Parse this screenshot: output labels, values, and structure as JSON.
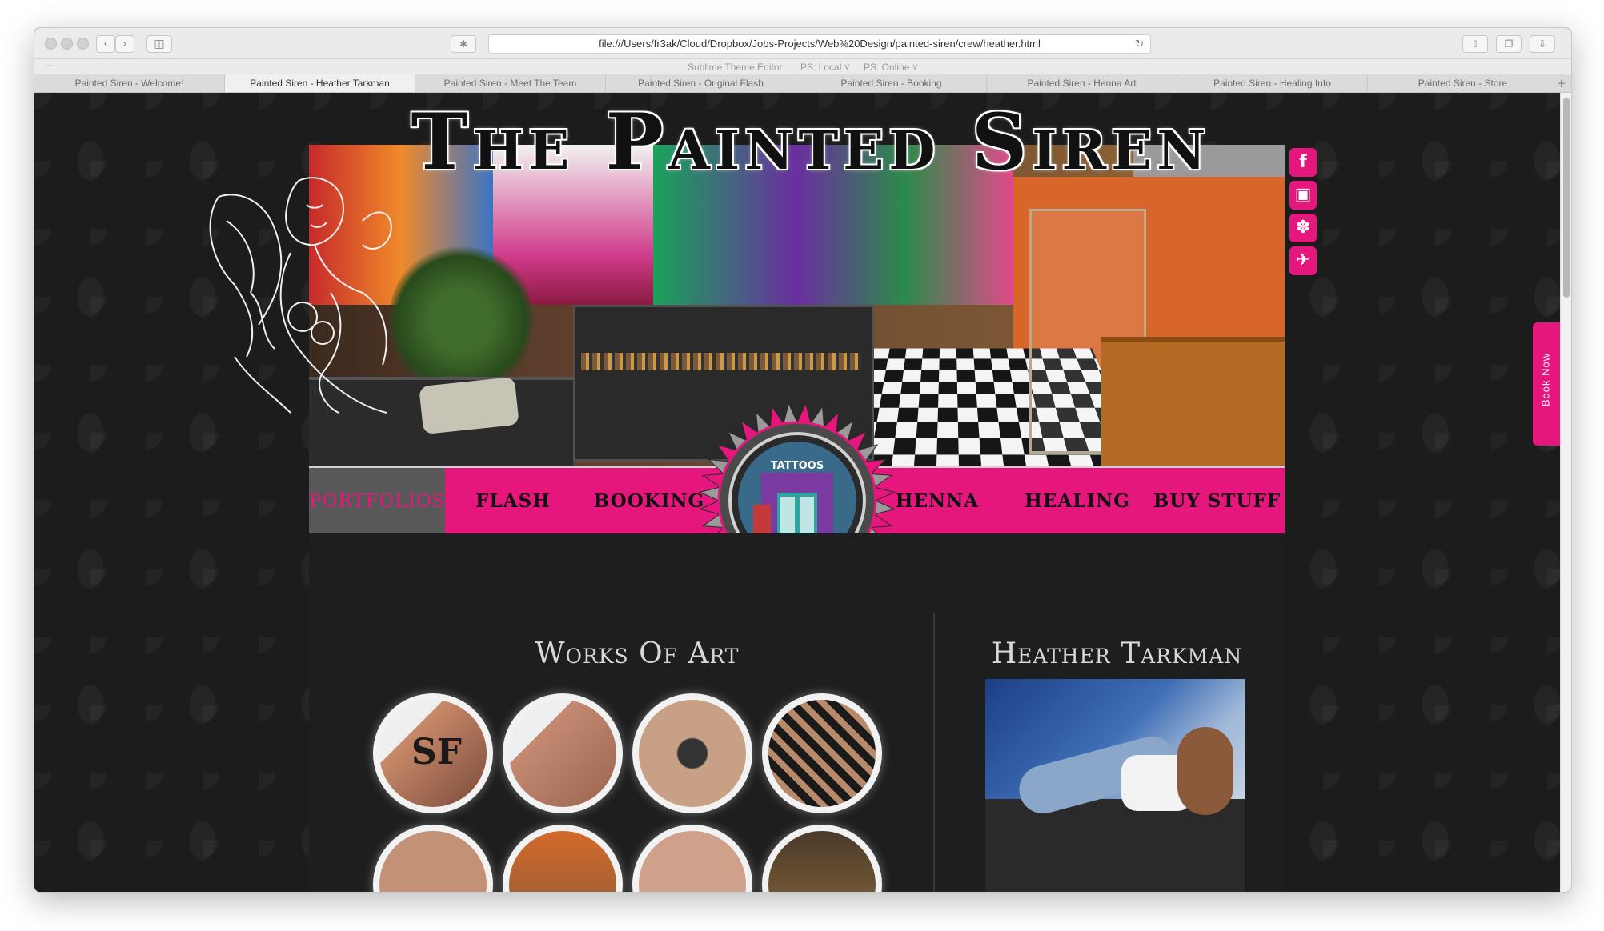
{
  "browser": {
    "url": "file:///Users/fr3ak/Cloud/Dropbox/Jobs-Projects/Web%20Design/painted-siren/crew/heather.html",
    "bookmarks": [
      "Sublime Theme Editor",
      "PS: Local ˅",
      "PS: Online ˅"
    ],
    "tabs": [
      "Painted Siren - Welcome!",
      "Painted Siren - Heather Tarkman",
      "Painted Siren - Meet The Team",
      "Painted Siren - Original Flash",
      "Painted Siren - Booking",
      "Painted Siren - Henna Art",
      "Painted Siren - Healing Info",
      "Painted Siren - Store"
    ],
    "active_tab_index": 1
  },
  "site": {
    "title": "The Painted Siren",
    "social": [
      "facebook-icon",
      "instagram-icon",
      "yelp-icon",
      "twitter-icon"
    ],
    "book_now": "Book Now",
    "accent_color": "#e5177d",
    "nav": [
      "PORTFOLIOS",
      "FLASH",
      "BOOKING",
      "HENNA",
      "HEALING",
      "BUY STUFF"
    ],
    "active_nav": "PORTFOLIOS",
    "badge_text": "TATTOOS"
  },
  "main": {
    "works_heading": "Works Of Art",
    "artist_heading": "Heather Tarkman"
  }
}
